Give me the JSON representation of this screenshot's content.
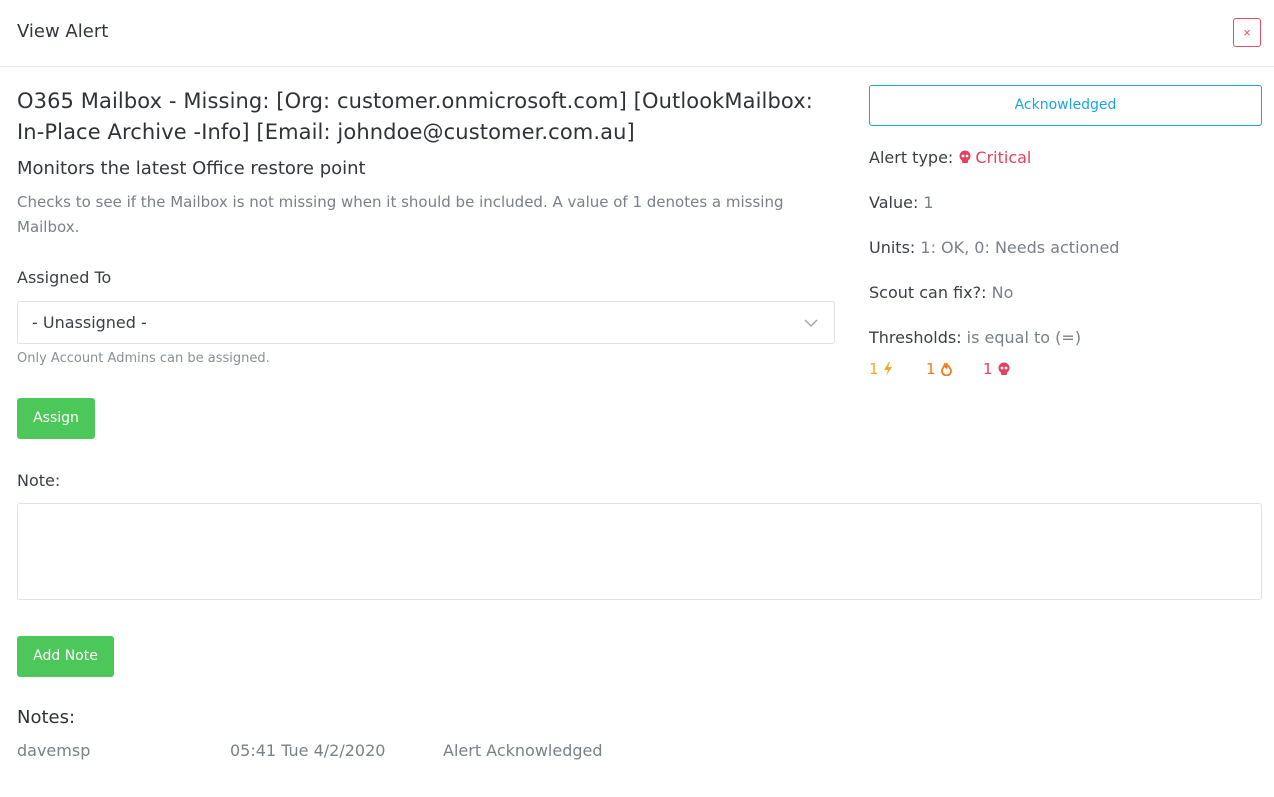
{
  "header": {
    "title": "View Alert",
    "close_label": "×"
  },
  "alert": {
    "title": "O365 Mailbox - Missing: [Org: customer.onmicrosoft.com] [OutlookMailbox: In-Place Archive -Info] [Email: johndoe@customer.com.au]",
    "subtitle": "Monitors the latest Office restore point",
    "description": "Checks to see if the Mailbox is not missing when it should be included. A value of 1 denotes a missing Mailbox."
  },
  "assign": {
    "label": "Assigned To",
    "selected": "- Unassigned -",
    "hint": "Only Account Admins can be assigned.",
    "button_label": "Assign"
  },
  "note": {
    "label": "Note:",
    "value": "",
    "button_label": "Add Note"
  },
  "notes": {
    "heading": "Notes:",
    "items": [
      {
        "user": "davemsp",
        "time": "05:41 Tue 4/2/2020",
        "text": "Alert Acknowledged"
      }
    ]
  },
  "status": {
    "button_label": "Acknowledged",
    "alert_type_key": "Alert type:",
    "alert_type_value": "Critical",
    "value_key": "Value:",
    "value_value": "1",
    "units_key": "Units:",
    "units_value": "1: OK, 0: Needs actioned",
    "scout_key": "Scout can fix?:",
    "scout_value": "No",
    "thresholds_key": "Thresholds:",
    "thresholds_value": "is equal to (=)",
    "thresholds": [
      {
        "level": "warning",
        "value": "1",
        "icon": "bolt-icon",
        "color": "#f5a623"
      },
      {
        "level": "high",
        "value": "1",
        "icon": "fire-icon",
        "color": "#f07a1e"
      },
      {
        "level": "critical",
        "value": "1",
        "icon": "skull-icon",
        "color": "#e6405c"
      }
    ]
  },
  "colors": {
    "primary_green": "#4cc85a",
    "accent_blue": "#1aa7e0",
    "critical_red": "#e6405c"
  }
}
